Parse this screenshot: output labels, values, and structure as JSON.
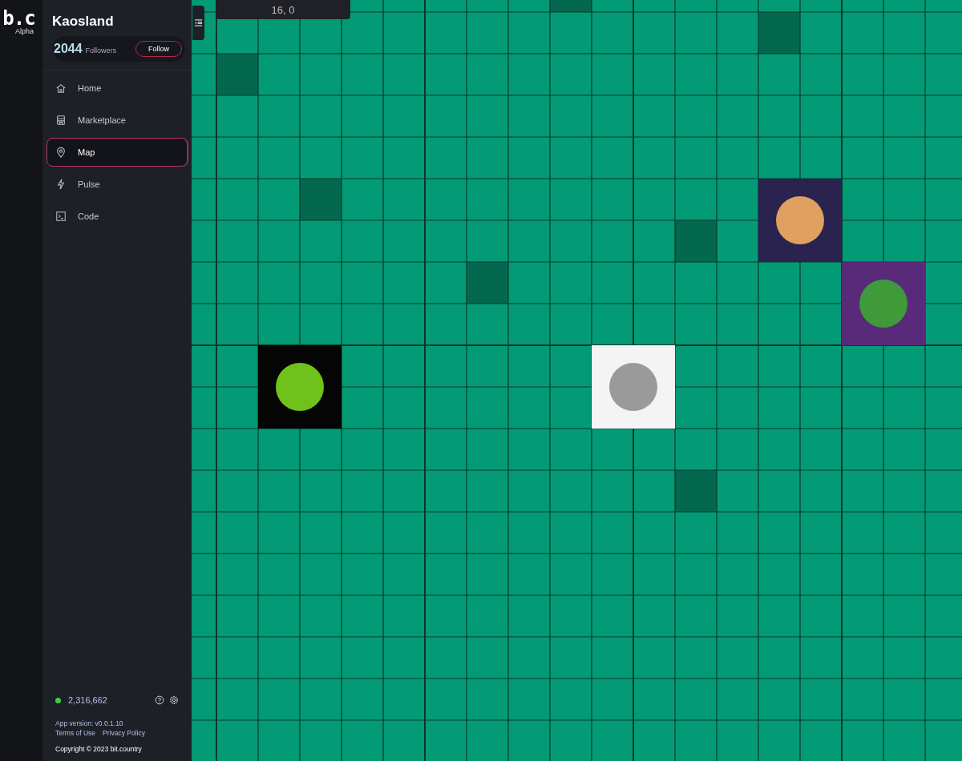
{
  "logo": {
    "mark": "b.c",
    "label": "Alpha"
  },
  "community": {
    "name": "Kaosland",
    "followers_count": "2044",
    "followers_label": "Followers",
    "follow_button": "Follow"
  },
  "nav": [
    {
      "label": "Home",
      "kind": "home",
      "selected": false
    },
    {
      "label": "Marketplace",
      "kind": "store",
      "selected": false
    },
    {
      "label": "Map",
      "kind": "pin",
      "selected": true
    },
    {
      "label": "Pulse",
      "kind": "bolt",
      "selected": false
    },
    {
      "label": "Code",
      "kind": "terminal",
      "selected": false
    }
  ],
  "status": {
    "online_count": "2,316,662"
  },
  "footer": {
    "version": "App version: v0.0.1.10",
    "links": [
      "Terms of Use",
      "Privacy Policy"
    ],
    "copyright": "Copyright © 2023 bit.country"
  },
  "map": {
    "coordinates": "16, 0"
  }
}
